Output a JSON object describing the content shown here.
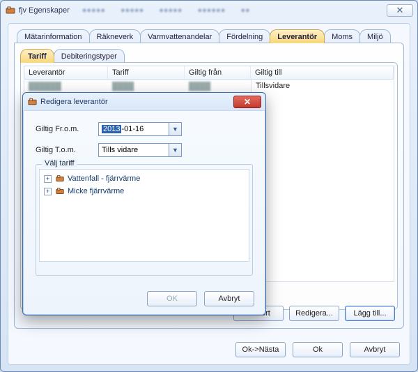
{
  "window": {
    "title": "fjv Egenskaper",
    "close_glyph": "✕",
    "toolbar_blur": [
      "Item1",
      "Item2",
      "Item3",
      "Item4",
      "Item5"
    ]
  },
  "tabs": {
    "items": [
      {
        "label": "Mätarinformation"
      },
      {
        "label": "Räkneverk"
      },
      {
        "label": "Varmvattenandelar"
      },
      {
        "label": "Fördelning"
      },
      {
        "label": "Leverantör"
      },
      {
        "label": "Moms"
      },
      {
        "label": "Miljö"
      }
    ],
    "sub": [
      {
        "label": "Tariff"
      },
      {
        "label": "Debiteringstyper"
      }
    ]
  },
  "table": {
    "headers": {
      "lev": "Leverantör",
      "tar": "Tariff",
      "fran": "Giltig från",
      "till": "Giltig till"
    },
    "row_till_value": "Tillsvidare"
  },
  "panel_buttons": {
    "tabort": "Ta bort",
    "redigera": "Redigera...",
    "lagg": "Lägg till..."
  },
  "footer": {
    "oknasta": "Ok->Nästa",
    "ok": "Ok",
    "avbryt": "Avbryt"
  },
  "dialog": {
    "title": "Redigera leverantör",
    "close_glyph": "✕",
    "from_label": "Giltig Fr.o.m.",
    "from_sel": "2013",
    "from_rest": "-01-16",
    "to_label": "Giltig T.o.m.",
    "to_value": "Tills vidare",
    "group_label": "Välj tariff",
    "tree": [
      {
        "label": "Vattenfall - fjärrvärme"
      },
      {
        "label": "Micke fjärrvärme"
      }
    ],
    "ok": "OK",
    "cancel": "Avbryt"
  }
}
